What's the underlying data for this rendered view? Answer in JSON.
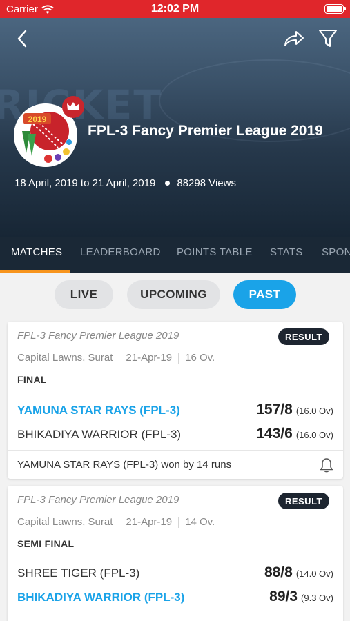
{
  "status_bar": {
    "carrier": "Carrier",
    "time": "12:02 PM"
  },
  "header": {
    "watermark": "RICKET",
    "title": "FPL-3 Fancy Premier League 2019",
    "dates": "18 April, 2019 to 21 April, 2019",
    "views": "88298 Views",
    "logo_text": "2019"
  },
  "tabs": [
    {
      "label": "MATCHES",
      "active": true
    },
    {
      "label": "LEADERBOARD",
      "active": false
    },
    {
      "label": "POINTS TABLE",
      "active": false
    },
    {
      "label": "STATS",
      "active": false
    },
    {
      "label": "SPON",
      "active": false
    }
  ],
  "filters": [
    {
      "label": "LIVE",
      "active": false
    },
    {
      "label": "UPCOMING",
      "active": false
    },
    {
      "label": "PAST",
      "active": true
    }
  ],
  "matches": [
    {
      "league": "FPL-3 Fancy Premier League 2019",
      "badge": "RESULT",
      "venue": "Capital Lawns, Surat",
      "date": "21-Apr-19",
      "overs": "16 Ov.",
      "stage": "FINAL",
      "teams": [
        {
          "name": "YAMUNA STAR RAYS (FPL-3)",
          "score": "157/8",
          "overs": "(16.0 Ov)",
          "winner": true
        },
        {
          "name": "BHIKADIYA WARRIOR (FPL-3)",
          "score": "143/6",
          "overs": "(16.0 Ov)",
          "winner": false
        }
      ],
      "result": "YAMUNA STAR RAYS (FPL-3) won by 14 runs"
    },
    {
      "league": "FPL-3 Fancy Premier League 2019",
      "badge": "RESULT",
      "venue": "Capital Lawns, Surat",
      "date": "21-Apr-19",
      "overs": "14 Ov.",
      "stage": "SEMI FINAL",
      "teams": [
        {
          "name": "SHREE TIGER (FPL-3)",
          "score": "88/8",
          "overs": "(14.0 Ov)",
          "winner": false
        },
        {
          "name": "BHIKADIYA WARRIOR (FPL-3)",
          "score": "89/3",
          "overs": "(9.3 Ov)",
          "winner": true
        }
      ]
    }
  ],
  "colors": {
    "status_bar": "#e0262b",
    "accent_blue": "#1aa3e8",
    "tab_indicator": "#f7941d",
    "badge_dark": "#1d2530"
  },
  "icons": {
    "back": "chevron-left-icon",
    "share": "share-icon",
    "filter": "filter-icon",
    "crown": "crown-icon",
    "bell": "bell-icon",
    "wifi": "wifi-icon",
    "battery": "battery-icon"
  }
}
